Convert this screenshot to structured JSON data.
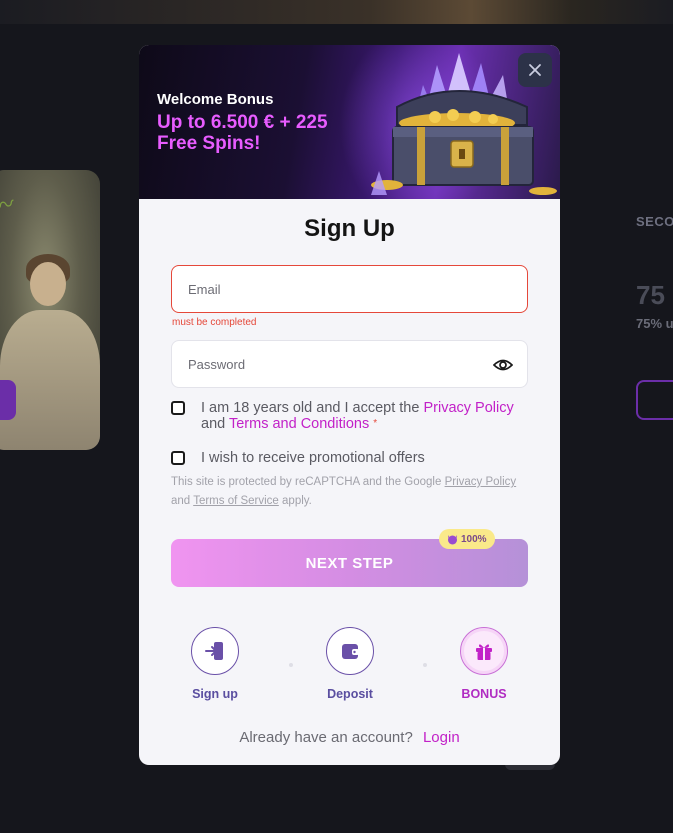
{
  "background": {
    "section_heading": "SECO",
    "bonus_value": "75",
    "bonus_desc": "75% u"
  },
  "banner": {
    "title": "Welcome Bonus",
    "subtitle": "Up to 6.500 € + 225 Free Spins!"
  },
  "modal": {
    "title": "Sign Up",
    "email": {
      "placeholder": "Email",
      "value": "",
      "error": "must be completed"
    },
    "password": {
      "placeholder": "Password",
      "value": ""
    },
    "age_checkbox": {
      "checked": false,
      "text_before": "I am 18 years old and I accept the ",
      "privacy_link": "Privacy Policy",
      "and": " and ",
      "terms_link": "Terms and Conditions",
      "required_marker": "*"
    },
    "promo_checkbox": {
      "checked": false,
      "text": "I wish to receive promotional offers"
    },
    "recaptcha": {
      "prefix": "This site is protected by reCAPTCHA and the Google ",
      "privacy_link": "Privacy Policy",
      "and": " and ",
      "terms_link": "Terms of Service",
      "suffix": " apply."
    },
    "next_button": "NEXT STEP",
    "progress_badge": "100%",
    "steps": [
      {
        "label": "Sign up",
        "icon": "signin-icon",
        "active": false
      },
      {
        "label": "Deposit",
        "icon": "wallet-icon",
        "active": false
      },
      {
        "label": "BONUS",
        "icon": "gift-icon",
        "active": true
      }
    ],
    "footer": {
      "question": "Already have an account?",
      "login_link": "Login"
    }
  },
  "colors": {
    "accent_pink": "#c221c8",
    "error_red": "#e5483a",
    "step_purple": "#5a4ea0",
    "background": "#15161c"
  }
}
